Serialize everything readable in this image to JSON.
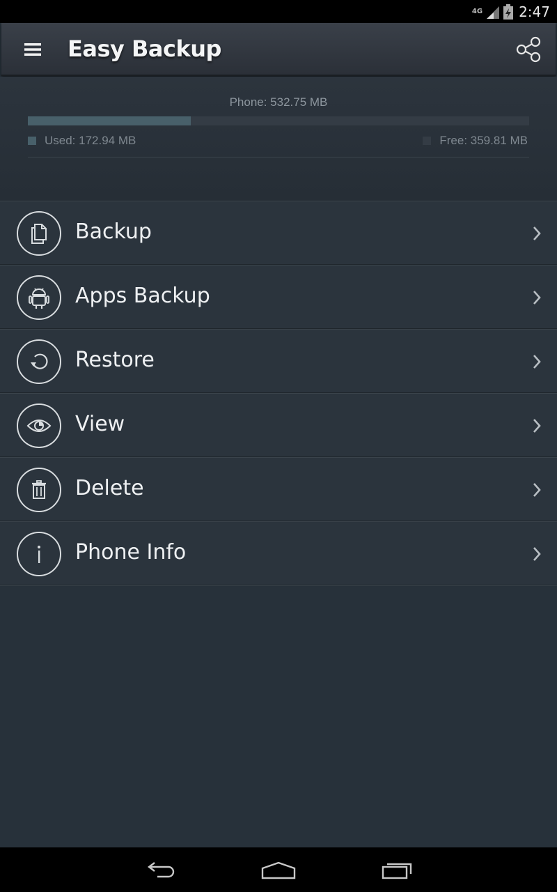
{
  "status_bar": {
    "network": "4G",
    "time": "2:47"
  },
  "app": {
    "title": "Easy Backup"
  },
  "icons": {
    "menu": "hamburger-icon",
    "share": "share-icon"
  },
  "storage": {
    "title": "Phone: 532.75 MB",
    "used_label": "Used: 172.94 MB",
    "free_label": "Free: 359.81 MB",
    "used_fraction": 0.3246,
    "used_color": "#48606a",
    "free_color": "#343c45"
  },
  "menu": {
    "items": [
      {
        "label": "Backup",
        "icon": "document-copy-icon"
      },
      {
        "label": "Apps Backup",
        "icon": "android-icon"
      },
      {
        "label": "Restore",
        "icon": "restore-icon"
      },
      {
        "label": "View",
        "icon": "eye-icon"
      },
      {
        "label": "Delete",
        "icon": "trash-icon"
      },
      {
        "label": "Phone Info",
        "icon": "info-icon"
      }
    ]
  },
  "nav": {
    "back": "back-icon",
    "home": "home-icon",
    "recents": "recents-icon"
  }
}
